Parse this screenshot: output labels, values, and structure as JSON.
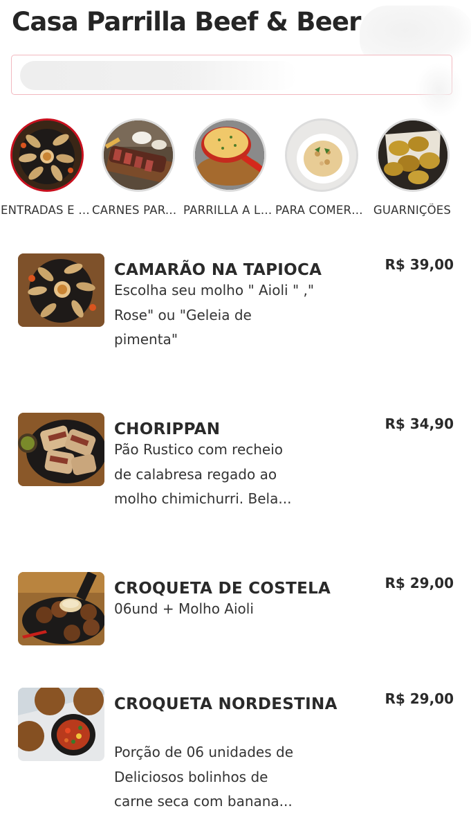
{
  "restaurant": {
    "title": "Casa Parrilla Beef & Beer"
  },
  "search": {
    "placeholder": "",
    "value": ""
  },
  "categories": [
    {
      "label": "ENTRADAS E PETISCOS",
      "active": true,
      "icon": "fried-shrimp-photo"
    },
    {
      "label": "CARNES PARA COMPARTILHAR",
      "active": false,
      "icon": "steak-photo"
    },
    {
      "label": "PARRILLA A LA CARTA",
      "active": false,
      "icon": "skillet-photo"
    },
    {
      "label": "PARA COMER SOZINHO",
      "active": false,
      "icon": "risotto-photo"
    },
    {
      "label": "GUARNIÇÕES",
      "active": false,
      "icon": "fried-side-photo"
    }
  ],
  "menu_items": [
    {
      "name": "CAMARÃO NA TAPIOCA",
      "desc_lines": [
        "Escolha seu molho \" Aioli \" ,\"",
        "Rose\" ou \"Geleia de",
        "pimenta\""
      ],
      "price": "R$ 39,00"
    },
    {
      "name": "CHORIPPAN",
      "desc_lines": [
        "Pão Rustico com recheio",
        "de calabresa regado ao",
        "molho chimichurri. Bela..."
      ],
      "price": "R$ 34,90"
    },
    {
      "name": "CROQUETA DE COSTELA",
      "desc_lines": [
        "06und + Molho Aioli"
      ],
      "price": "R$ 29,00"
    },
    {
      "name": "CROQUETA NORDESTINA",
      "desc_lines": [
        "Porção de 06 unidades de",
        "Deliciosos bolinhos de",
        "carne seca com banana..."
      ],
      "price": "R$ 29,00"
    }
  ],
  "colors": {
    "accent": "#c8101e",
    "search_border": "#f2b8bf",
    "text": "#2a2a2a"
  }
}
